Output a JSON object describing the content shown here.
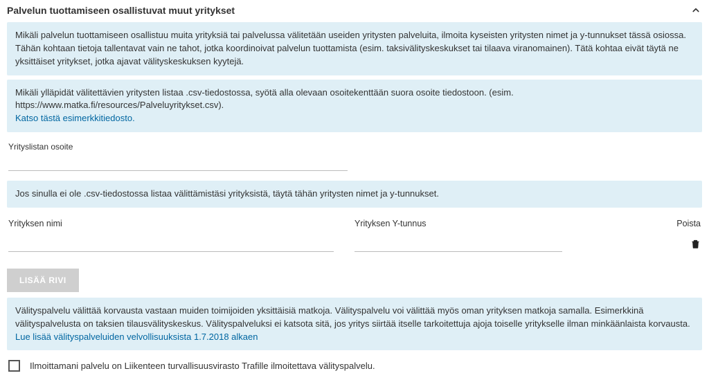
{
  "section": {
    "title": "Palvelun tuottamiseen osallistuvat muut yritykset"
  },
  "info1": {
    "text": "Mikäli palvelun tuottamiseen osallistuu muita yrityksiä tai palvelussa välitetään useiden yritysten palveluita, ilmoita kyseisten yritysten nimet ja y-tunnukset tässä osiossa. Tähän kohtaan tietoja tallentavat vain ne tahot, jotka koordinoivat palvelun tuottamista (esim. taksivälityskeskukset tai tilaava viranomainen). Tätä kohtaa eivät täytä ne yksittäiset yritykset, jotka ajavat välityskeskuksen kyytejä."
  },
  "info2": {
    "text": "Mikäli ylläpidät välitettävien yritysten listaa .csv-tiedostossa, syötä alla olevaan osoitekenttään suora osoite tiedostoon. (esim. https://www.matka.fi/resources/Palveluyritykset.csv).",
    "link": "Katso tästä esimerkkitiedosto."
  },
  "urlField": {
    "label": "Yrityslistan osoite",
    "value": ""
  },
  "info3": {
    "text": "Jos sinulla ei ole .csv-tiedostossa listaa välittämistäsi yrityksistä, täytä tähän yritysten nimet ja y-tunnukset."
  },
  "table": {
    "headers": {
      "name": "Yrityksen nimi",
      "ytunnus": "Yrityksen Y-tunnus",
      "delete": "Poista"
    },
    "rows": [
      {
        "name": "",
        "ytunnus": ""
      }
    ]
  },
  "addRow": {
    "label": "LISÄÄ RIVI"
  },
  "info4": {
    "text": "Välityspalvelu välittää korvausta vastaan muiden toimijoiden yksittäisiä matkoja. Välityspalvelu voi välittää myös oman yrityksen matkoja samalla. Esimerkkinä välityspalvelusta on taksien tilausvälityskeskus. Välityspalveluksi ei katsota sitä, jos yritys siirtää itselle tarkoitettuja ajoja toiselle yritykselle ilman minkäänlaista korvausta.",
    "link": "Lue lisää välityspalveluiden velvollisuuksista 1.7.2018 alkaen"
  },
  "checkbox": {
    "label": "Ilmoittamani palvelu on Liikenteen turvallisuusvirasto Trafille ilmoitettava välityspalvelu.",
    "checked": false
  }
}
